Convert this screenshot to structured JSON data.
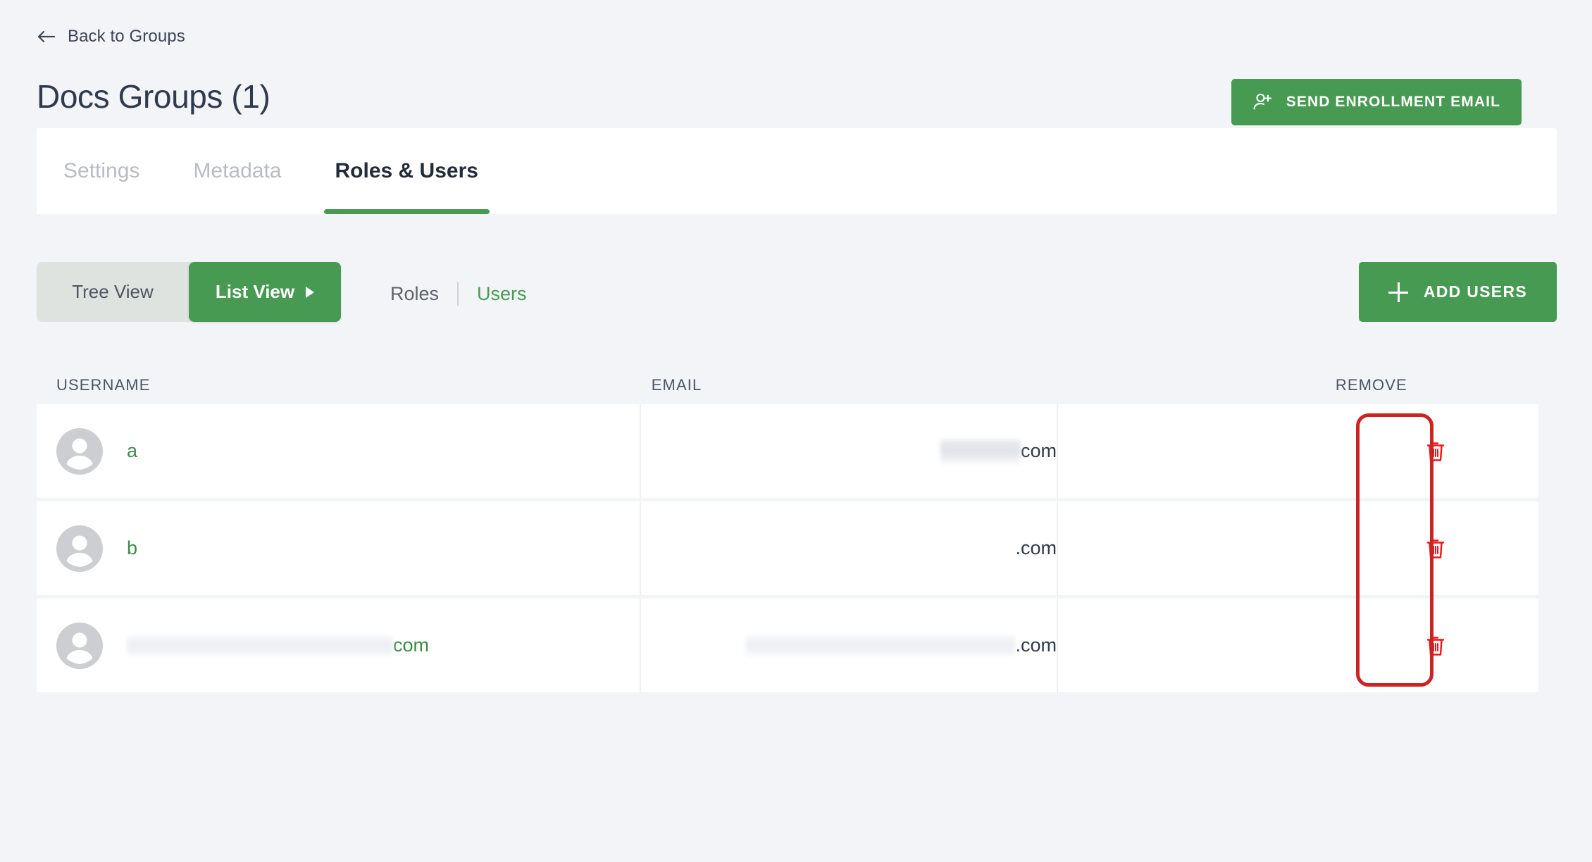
{
  "colors": {
    "page_background": "#f2f4f7",
    "brand_green": "#479a52",
    "link_green": "#3c8c46",
    "title_slate": "#2f3a4d",
    "annotation_red": "#cc2222",
    "trash_red": "#f01616",
    "toggle_track": "#dfe3e0"
  },
  "back_link": {
    "label": "Back to Groups",
    "icon": "arrow-left-icon"
  },
  "header": {
    "title": "Docs Groups (1)",
    "enroll_button": {
      "label": "SEND ENROLLMENT EMAIL",
      "icon": "person-add-icon"
    }
  },
  "tabs": [
    {
      "label": "Settings",
      "active": false
    },
    {
      "label": "Metadata",
      "active": false
    },
    {
      "label": "Roles & Users",
      "active": true
    }
  ],
  "toolbar": {
    "view_toggle": [
      {
        "label": "Tree View",
        "active": false
      },
      {
        "label": "List View",
        "active": true,
        "icon": "caret-right-icon"
      }
    ],
    "subnav": [
      {
        "label": "Roles",
        "active": false
      },
      {
        "label": "Users",
        "active": true
      }
    ],
    "add_users_button": {
      "label": "ADD USERS",
      "icon": "plus-icon"
    }
  },
  "table": {
    "columns": [
      "USERNAME",
      "EMAIL",
      "REMOVE"
    ],
    "rows": [
      {
        "avatar": "user-avatar-icon",
        "username_redacted": false,
        "username": "a",
        "username_redact_width": 0,
        "email_redacted": true,
        "email_redact_width": 114,
        "email": "com",
        "remove_icon": "trash-icon"
      },
      {
        "avatar": "user-avatar-icon",
        "username_redacted": false,
        "username": "b",
        "username_redact_width": 0,
        "email_redacted": false,
        "email_redact_width": 0,
        "email": ".com",
        "remove_icon": "trash-icon"
      },
      {
        "avatar": "user-avatar-icon",
        "username_redacted": true,
        "username": "com",
        "username_redact_width": 378,
        "email_redacted": true,
        "email_redact_width": 382,
        "email": ".com",
        "remove_icon": "trash-icon"
      }
    ]
  },
  "annotation": {
    "shape": "rounded-rectangle-highlight",
    "target": "remove-column-trash-buttons",
    "color": "#cc2222"
  }
}
